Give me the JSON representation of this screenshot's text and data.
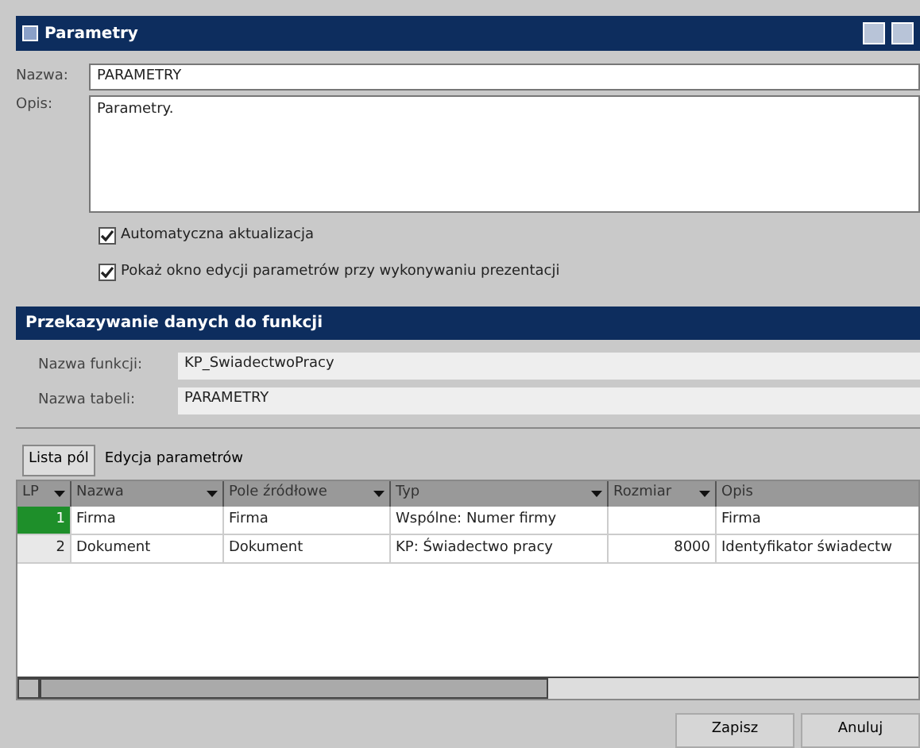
{
  "window": {
    "title": "Parametry"
  },
  "form": {
    "name_label": "Nazwa:",
    "name_value": "PARAMETRY",
    "desc_label": "Opis:",
    "desc_value": "Parametry.",
    "checkboxes": [
      {
        "label": "Automatyczna aktualizacja",
        "checked": true
      },
      {
        "label": "Pokaż okno edycji parametrów przy wykonywaniu prezentacji",
        "checked": true
      }
    ]
  },
  "section": {
    "title": "Przekazywanie danych do funkcji",
    "fields": [
      {
        "label": "Nazwa funkcji:",
        "value": "KP_SwiadectwoPracy"
      },
      {
        "label": "Nazwa tabeli:",
        "value": "PARAMETRY"
      }
    ]
  },
  "tabs": [
    {
      "label": "Lista pól",
      "selected": true
    },
    {
      "label": "Edycja parametrów",
      "selected": false
    }
  ],
  "table": {
    "columns": [
      "LP",
      "Nazwa",
      "Pole źródłowe",
      "Typ",
      "Rozmiar",
      "Opis"
    ],
    "rows": [
      {
        "cells": [
          "1",
          "Firma",
          "Firma",
          "Wspólne: Numer firmy",
          "",
          "Firma"
        ],
        "selected": true
      },
      {
        "cells": [
          "2",
          "Dokument",
          "Dokument",
          "KP: Świadectwo pracy",
          "8000",
          "Identyfikator świadectw"
        ],
        "selected": false
      }
    ]
  },
  "buttons": [
    "Zapisz",
    "Anuluj"
  ]
}
